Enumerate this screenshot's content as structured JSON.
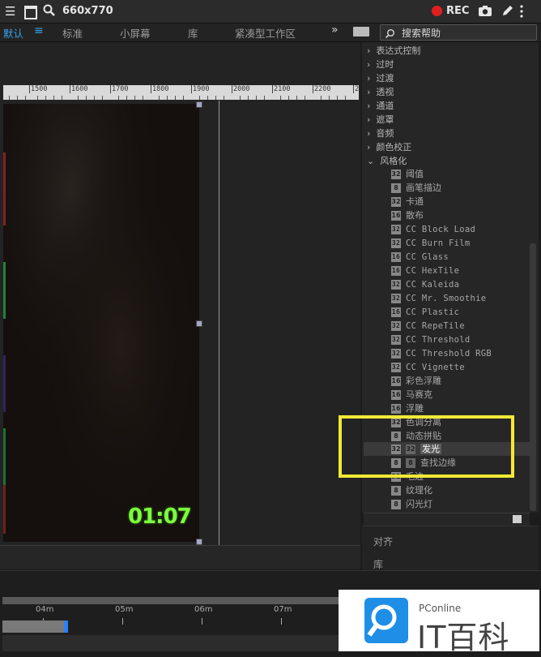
{
  "recorder": {
    "size_label": "660x770",
    "rec_label": "REC",
    "rec_color": "#e0201f"
  },
  "workspace": {
    "tabs": [
      "默认",
      "标准",
      "小屏幕",
      "库",
      "紧凑型工作区"
    ],
    "active_tab": "默认",
    "menu_icon": "hamburger-icon",
    "more": "»",
    "search_placeholder": "搜索帮助"
  },
  "ruler": {
    "ticks": [
      "1500",
      "1600",
      "1700",
      "1800",
      "1900",
      "2000",
      "2100",
      "2200",
      "2"
    ]
  },
  "viewer": {
    "timecode": "01:07",
    "timecode_color": "#7cff3e"
  },
  "effects": {
    "categories": [
      "表达式控制",
      "过时",
      "过渡",
      "透视",
      "通道",
      "遮罩",
      "音频",
      "颜色校正"
    ],
    "expanded_category": "风格化",
    "items": [
      {
        "label": "阈值",
        "bits": "32"
      },
      {
        "label": "画笔描边",
        "bits": "8"
      },
      {
        "label": "卡通",
        "bits": "32"
      },
      {
        "label": "散布",
        "bits": "16"
      },
      {
        "label": "CC Block Load",
        "bits": "32"
      },
      {
        "label": "CC Burn Film",
        "bits": "32"
      },
      {
        "label": "CC Glass",
        "bits": "16"
      },
      {
        "label": "CC HexTile",
        "bits": "16"
      },
      {
        "label": "CC Kaleida",
        "bits": "32"
      },
      {
        "label": "CC Mr. Smoothie",
        "bits": "32"
      },
      {
        "label": "CC Plastic",
        "bits": "16"
      },
      {
        "label": "CC RepeTile",
        "bits": "32"
      },
      {
        "label": "CC Threshold",
        "bits": "32"
      },
      {
        "label": "CC Threshold RGB",
        "bits": "32"
      },
      {
        "label": "CC Vignette",
        "bits": "32"
      },
      {
        "label": "彩色浮雕",
        "bits": "16"
      },
      {
        "label": "马赛克",
        "bits": "16"
      },
      {
        "label": "浮雕",
        "bits": "16"
      },
      {
        "label": "色调分离",
        "bits": "32"
      },
      {
        "label": "动态拼贴",
        "bits": "8"
      },
      {
        "label": "发光",
        "bits": "32",
        "selected": true
      },
      {
        "label": "查找边缘",
        "bits": "8"
      },
      {
        "label": "毛边",
        "bits": "32"
      },
      {
        "label": "纹理化",
        "bits": "8"
      },
      {
        "label": "闪光灯",
        "bits": "8"
      }
    ],
    "highlight_color": "#f3e934"
  },
  "panels": {
    "align": "对齐",
    "library": "库"
  },
  "timeline": {
    "marks": [
      "04m",
      "05m",
      "06m",
      "07m"
    ],
    "cti_color": "#2b7fff"
  },
  "watermark": {
    "brand_small": "PConline",
    "brand_large": "IT百科"
  }
}
